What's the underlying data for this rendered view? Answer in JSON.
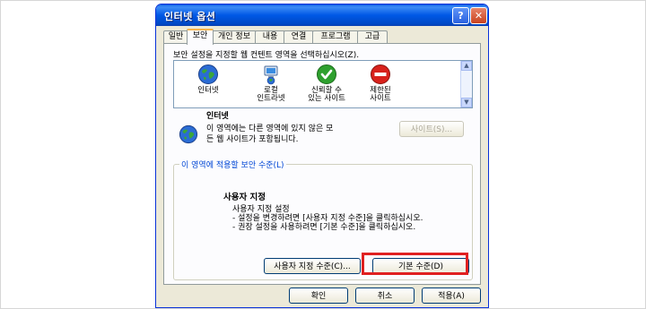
{
  "window": {
    "title": "인터넷 옵션"
  },
  "titlebar_buttons": {
    "help_glyph": "?",
    "close_glyph": "✕"
  },
  "tabs": [
    {
      "label": "일반"
    },
    {
      "label": "보안"
    },
    {
      "label": "개인 정보"
    },
    {
      "label": "내용"
    },
    {
      "label": "연결"
    },
    {
      "label": "프로그램"
    },
    {
      "label": "고급"
    }
  ],
  "active_tab": "보안",
  "security": {
    "zone_prompt": "보안 설정을 지정할 웹 컨텐트 영역을 선택하십시오(Z).",
    "zones": [
      {
        "label_lines": [
          "인터넷"
        ],
        "icon": "globe-icon"
      },
      {
        "label_lines": [
          "로컬",
          "인트라넷"
        ],
        "icon": "computer-network-icon"
      },
      {
        "label_lines": [
          "신뢰할 수",
          "있는 사이트"
        ],
        "icon": "green-check-icon"
      },
      {
        "label_lines": [
          "제한된",
          "사이트"
        ],
        "icon": "red-no-entry-icon"
      }
    ],
    "selected_zone": {
      "name": "인터넷",
      "description_lines": [
        "이 영역에는 다른 영역에 있지 않은 모",
        "든 웹 사이트가 포함됩니다."
      ],
      "sites_button": "사이트(S)..."
    },
    "level_group": {
      "legend": "이 영역에 적용할 보안 수준(L)",
      "title": "사용자 지정",
      "lines": [
        "사용자 지정 설정",
        "- 설정을 변경하려면 [사용자 지정 수준]을 클릭하십시오.",
        "- 권장 설정을 사용하려면 [기본 수준]을 클릭하십시오."
      ],
      "custom_button": "사용자 지정 수준(C)...",
      "default_button": "기본 수준(D)"
    }
  },
  "footer": {
    "ok": "확인",
    "cancel": "취소",
    "apply": "적용(A)"
  },
  "colors": {
    "titlebar": "#0058e6",
    "highlight": "#e02020",
    "dialog_bg": "#ece9d8"
  }
}
